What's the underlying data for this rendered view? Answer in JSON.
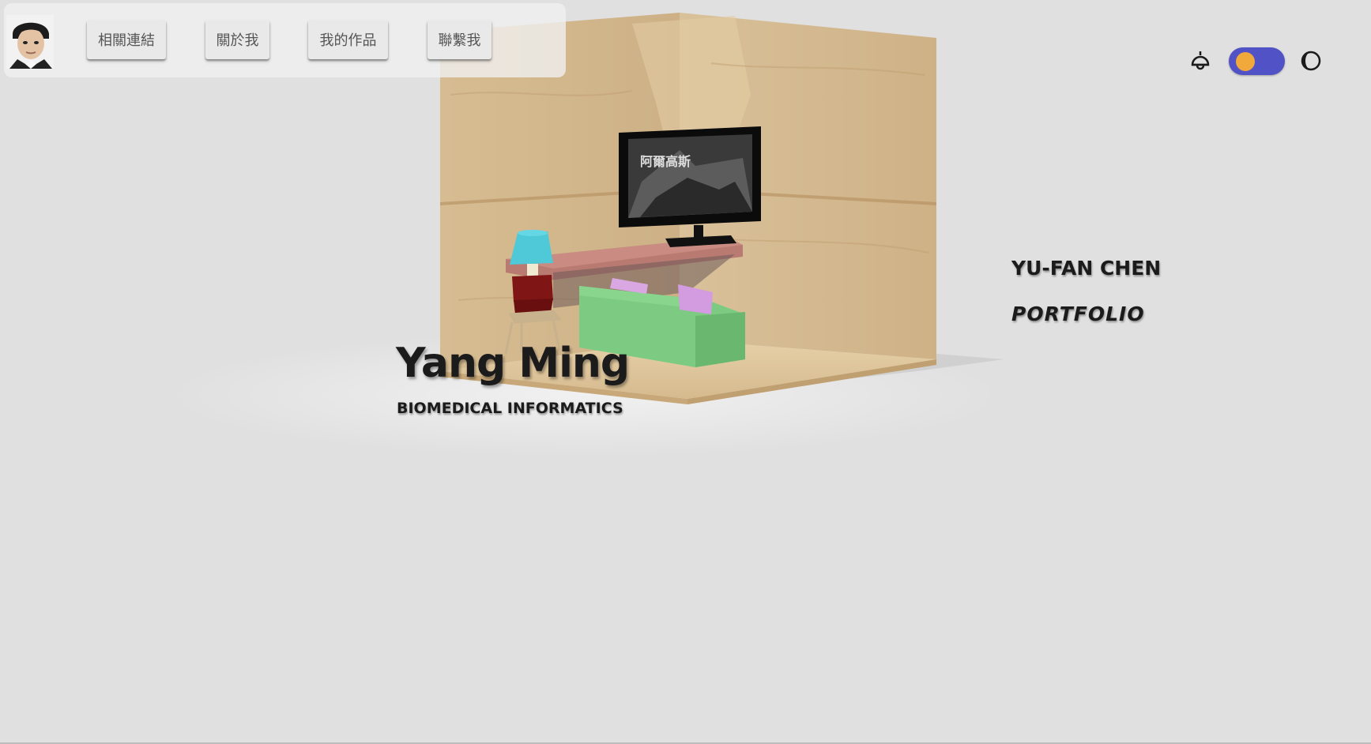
{
  "nav": {
    "links": [
      {
        "label": "相關連結"
      },
      {
        "label": "關於我"
      },
      {
        "label": "我的作品"
      },
      {
        "label": "聯繫我"
      }
    ]
  },
  "theme": {
    "lamp_icon": "ceiling-lamp-icon",
    "moon_icon": "half-moon-icon",
    "toggle_colors": {
      "track": "#5252c7",
      "knob": "#f0a93a"
    }
  },
  "hero": {
    "title": "Yang Ming",
    "subtitle": "BIOMEDICAL INFORMATICS"
  },
  "side": {
    "name": "YU-FAN CHEN",
    "portfolio": "PORTFOLIO"
  },
  "tv_screen": {
    "caption": "阿爾高斯"
  }
}
